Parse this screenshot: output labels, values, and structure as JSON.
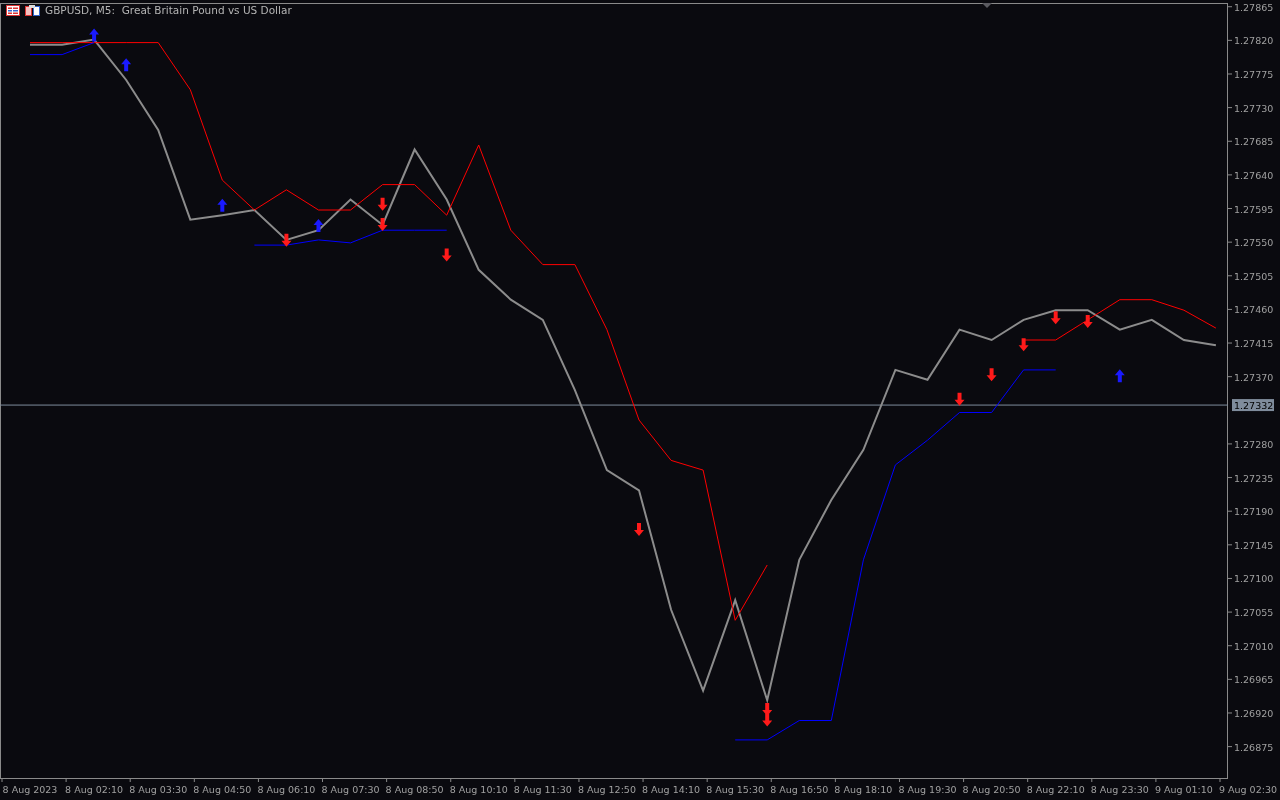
{
  "chart": {
    "title": "GBPUSD, M5:  Great Britain Pound vs US Dollar",
    "chart_data": {
      "type": "line",
      "categories": [
        "8 Aug 2023",
        null,
        "8 Aug 02:10",
        null,
        "8 Aug 03:30",
        null,
        "8 Aug 04:50",
        null,
        "8 Aug 06:10",
        null,
        "8 Aug 07:30",
        null,
        "8 Aug 08:50",
        null,
        "8 Aug 10:10",
        null,
        "8 Aug 11:30",
        null,
        "8 Aug 12:50",
        null,
        "8 Aug 14:10",
        null,
        "8 Aug 15:30",
        null,
        "8 Aug 16:50",
        null,
        "8 Aug 18:10",
        null,
        "8 Aug 19:30",
        null,
        "8 Aug 20:50",
        null,
        "8 Aug 22:10",
        null,
        "8 Aug 23:30",
        null,
        "9 Aug 01:10",
        null,
        "9 Aug 02:30"
      ],
      "ylim": [
        1.26833,
        1.27874
      ],
      "series": [
        {
          "color": "#8c8c8c",
          "values": [
            1.27814,
            1.27814,
            1.27821,
            1.27767,
            1.277,
            1.2758,
            1.27586,
            1.27593,
            1.27553,
            1.27566,
            1.27607,
            1.27573,
            1.27674,
            1.27607,
            1.27513,
            1.27473,
            1.27446,
            1.27352,
            1.27245,
            1.27218,
            1.27058,
            1.2695,
            1.27071,
            1.26937,
            1.27125,
            1.27205,
            1.27272,
            1.27379,
            1.27366,
            1.27433,
            1.27419,
            1.27446,
            1.27459,
            1.27459,
            1.27433,
            1.27446,
            1.27419,
            1.27412,
            null
          ]
        },
        {
          "color": "#ff0000",
          "values": [
            1.27817,
            1.27817,
            1.27817,
            1.27817,
            1.27817,
            1.27754,
            1.27633,
            1.27593,
            1.2762,
            1.27593,
            1.27593,
            1.27627,
            1.27627,
            1.27586,
            1.2768,
            1.27566,
            1.2752,
            1.2752,
            1.27433,
            1.27312,
            1.27258,
            1.27245,
            1.27044,
            1.27118,
            null,
            null,
            null,
            null,
            null,
            null,
            null,
            1.27419,
            1.27419,
            1.27446,
            1.27473,
            1.27473,
            1.27459,
            1.27435,
            null
          ]
        },
        {
          "color": "#0000ff",
          "values": [
            1.27801,
            1.27801,
            1.27817,
            null,
            null,
            null,
            null,
            1.27546,
            1.27546,
            1.27553,
            1.27549,
            1.27566,
            1.27566,
            1.27566,
            null,
            null,
            null,
            null,
            null,
            null,
            null,
            null,
            1.26884,
            1.26884,
            1.2691,
            1.2691,
            1.27125,
            1.27252,
            1.27285,
            1.27322,
            1.27322,
            1.27379,
            1.27379,
            null,
            null,
            null,
            null,
            null,
            null
          ]
        },
        {
          "type": "scatter",
          "color": "#1a1aff",
          "values": [
            null,
            null,
            1.27828,
            1.27788,
            null,
            null,
            1.276,
            null,
            null,
            1.27573,
            null,
            null,
            null,
            null,
            null,
            null,
            null,
            null,
            null,
            null,
            null,
            null,
            null,
            null,
            null,
            null,
            null,
            null,
            null,
            null,
            null,
            null,
            null,
            null,
            1.27372,
            null,
            null,
            null,
            null
          ]
        },
        {
          "type": "scatter",
          "color": "#ff1a1a",
          "values": [
            null,
            null,
            null,
            null,
            null,
            null,
            null,
            null,
            1.27552,
            null,
            null,
            1.276,
            null,
            1.27532,
            null,
            null,
            null,
            null,
            null,
            1.27165,
            null,
            null,
            null,
            1.26924,
            null,
            null,
            null,
            null,
            null,
            1.27339,
            1.27372,
            null,
            1.27448,
            1.27443,
            null,
            null,
            null,
            null,
            null
          ]
        },
        {
          "type": "scatter",
          "color": "#ff1a1a",
          "values": [
            null,
            null,
            null,
            null,
            null,
            null,
            null,
            null,
            null,
            null,
            null,
            1.27573,
            null,
            null,
            null,
            null,
            null,
            null,
            null,
            null,
            null,
            null,
            null,
            1.2691,
            null,
            null,
            null,
            null,
            null,
            null,
            null,
            1.27412,
            null,
            null,
            null,
            null,
            null,
            null,
            null
          ]
        }
      ],
      "yticks": [
        {
          "value": 1.27865,
          "label": "1.27865"
        },
        {
          "value": 1.2782,
          "label": "1.27820"
        },
        {
          "value": 1.27775,
          "label": "1.27775"
        },
        {
          "value": 1.2773,
          "label": "1.27730"
        },
        {
          "value": 1.27685,
          "label": "1.27685"
        },
        {
          "value": 1.2764,
          "label": "1.27640"
        },
        {
          "value": 1.27595,
          "label": "1.27595"
        },
        {
          "value": 1.2755,
          "label": "1.27550"
        },
        {
          "value": 1.27505,
          "label": "1.27505"
        },
        {
          "value": 1.2746,
          "label": "1.27460"
        },
        {
          "value": 1.27415,
          "label": "1.27415"
        },
        {
          "value": 1.2737,
          "label": "1.27370"
        },
        {
          "value": 1.2728,
          "label": "1.27280"
        },
        {
          "value": 1.27235,
          "label": "1.27235"
        },
        {
          "value": 1.2719,
          "label": "1.27190"
        },
        {
          "value": 1.27145,
          "label": "1.27145"
        },
        {
          "value": 1.271,
          "label": "1.27100"
        },
        {
          "value": 1.27055,
          "label": "1.27055"
        },
        {
          "value": 1.2701,
          "label": "1.27010"
        },
        {
          "value": 1.26965,
          "label": "1.26965"
        },
        {
          "value": 1.2692,
          "label": "1.26920"
        },
        {
          "value": 1.26875,
          "label": "1.26875"
        }
      ],
      "ref_lines": [
        {
          "axis": "y",
          "value": 1.27332,
          "label": "1.27332"
        }
      ]
    }
  }
}
